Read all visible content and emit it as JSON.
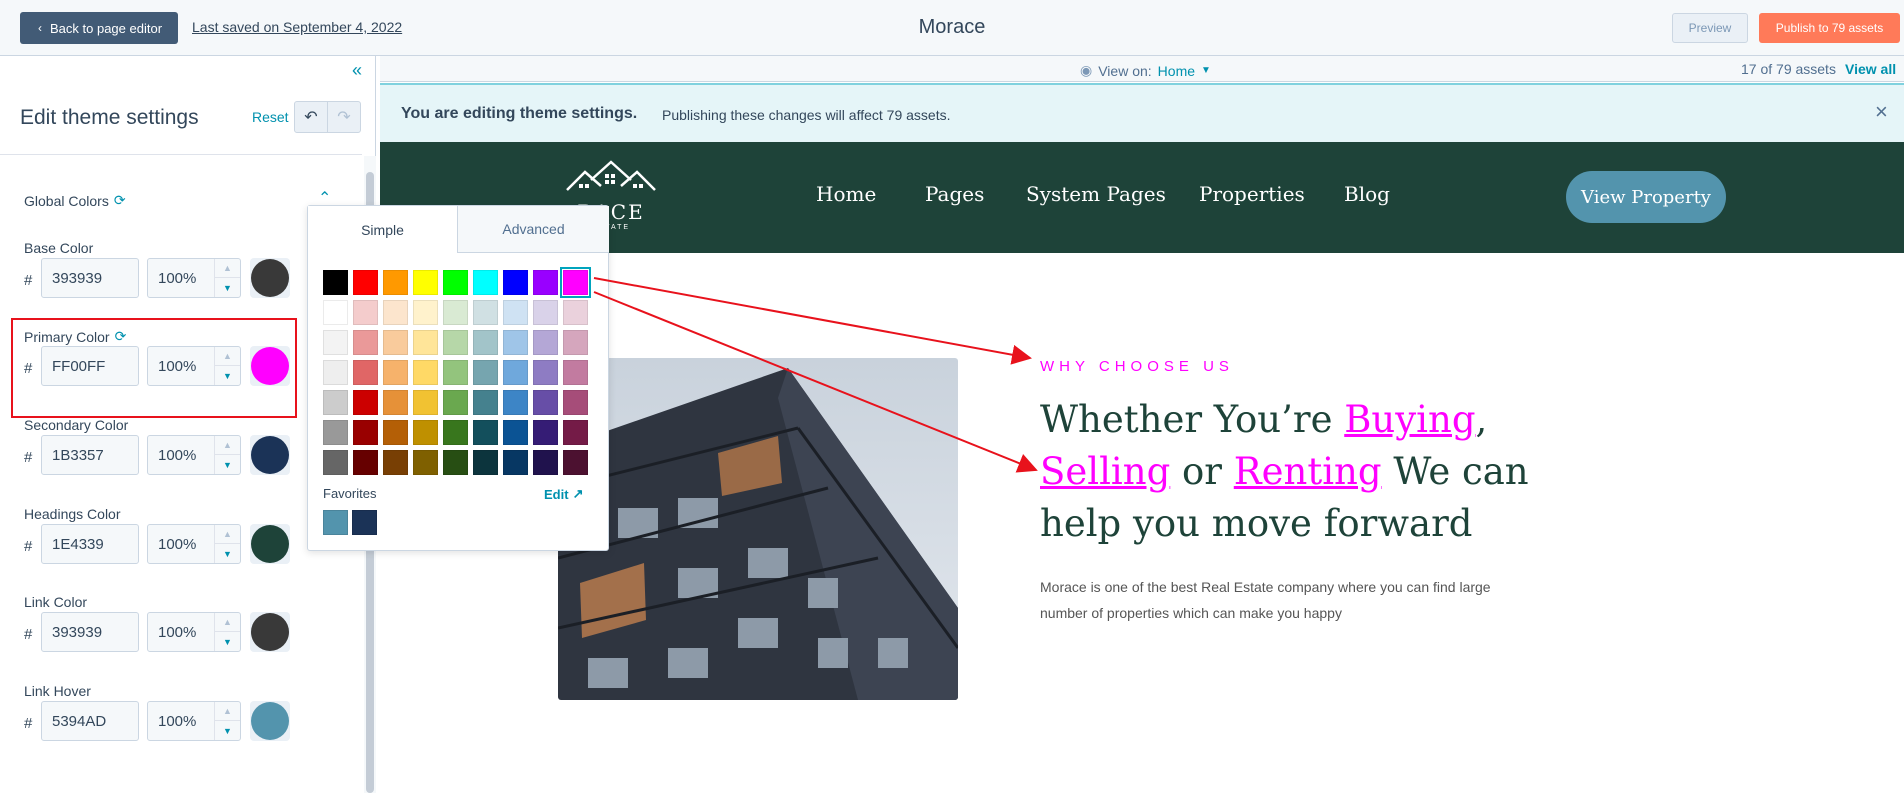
{
  "topbar": {
    "back_label": "Back to page editor",
    "saved_label": "Last saved on September 4, 2022",
    "title": "Morace",
    "preview_label": "Preview",
    "publish_label": "Publish to 79 assets"
  },
  "panel": {
    "title": "Edit theme settings",
    "reset_label": "Reset",
    "group_title": "Global Colors",
    "colors": [
      {
        "label": "Base Color",
        "hex": "393939",
        "opacity": "100%",
        "swatch": "#393939"
      },
      {
        "label": "Primary Color",
        "hex": "FF00FF",
        "opacity": "100%",
        "swatch": "#ff00ff"
      },
      {
        "label": "Secondary Color",
        "hex": "1B3357",
        "opacity": "100%",
        "swatch": "#1b3357"
      },
      {
        "label": "Headings Color",
        "hex": "1E4339",
        "opacity": "100%",
        "swatch": "#1e4339"
      },
      {
        "label": "Link Color",
        "hex": "393939",
        "opacity": "100%",
        "swatch": "#393939"
      },
      {
        "label": "Link Hover",
        "hex": "5394AD",
        "opacity": "100%",
        "swatch": "#5394ad"
      }
    ],
    "hash": "#"
  },
  "picker": {
    "tab_simple": "Simple",
    "tab_advanced": "Advanced",
    "favorites_label": "Favorites",
    "edit_label": "Edit",
    "palette": [
      [
        "#000000",
        "#ff0000",
        "#ff9900",
        "#ffff00",
        "#00ff00",
        "#00ffff",
        "#0000ff",
        "#9900ff",
        "#ff00ff"
      ],
      [
        "#ffffff",
        "#f4cccc",
        "#fce5cd",
        "#fff2cc",
        "#d9ead3",
        "#d0e0e3",
        "#cfe2f3",
        "#d9d2e9",
        "#ead1dc"
      ],
      [
        "#f3f3f3",
        "#ea9999",
        "#f9cb9c",
        "#ffe599",
        "#b6d7a8",
        "#a2c4c9",
        "#9fc5e8",
        "#b4a7d6",
        "#d5a6bd"
      ],
      [
        "#eeeeee",
        "#e06666",
        "#f6b26b",
        "#ffd966",
        "#93c47d",
        "#76a5af",
        "#6fa8dc",
        "#8e7cc3",
        "#c27ba0"
      ],
      [
        "#cccccc",
        "#cc0000",
        "#e69138",
        "#f1c232",
        "#6aa84f",
        "#45818e",
        "#3d85c6",
        "#674ea7",
        "#a64d79"
      ],
      [
        "#999999",
        "#990000",
        "#b45f06",
        "#bf9000",
        "#38761d",
        "#134f5c",
        "#0b5394",
        "#351c75",
        "#741b47"
      ],
      [
        "#666666",
        "#660000",
        "#783f04",
        "#7f6000",
        "#274e13",
        "#0c343d",
        "#073763",
        "#20124d",
        "#4c1130"
      ]
    ],
    "favorites": [
      "#5394ad",
      "#1b3357"
    ]
  },
  "preview": {
    "view_on_label": "View on:",
    "view_on_value": "Home",
    "assets_count": "17 of 79 assets",
    "view_all": "View all",
    "banner_strong": "You are editing theme settings.",
    "banner_text": "Publishing these changes will affect 79 assets."
  },
  "site": {
    "logo_text": "RACE",
    "logo_sub": "ESTATE",
    "nav": [
      "Home",
      "Pages",
      "System Pages",
      "Properties",
      "Blog"
    ],
    "cta": "View Property",
    "eyebrow": "WHY CHOOSE US",
    "headline_1": "Whether You’re ",
    "headline_buying": "Buying",
    "headline_comma": ",",
    "headline_selling": "Selling",
    "headline_or": " or ",
    "headline_renting": "Renting",
    "headline_rest": " We can help you move forward",
    "body": "Morace is one of the best Real Estate company where you can find large number of properties which can make you happy"
  },
  "colors": {
    "header_bg": "#1e4339",
    "primary": "#ff00ff",
    "accent": "#0091ae",
    "publish": "#ff7a59",
    "annotation": "#e8121c"
  },
  "icons": [
    "chevron-left-icon",
    "collapse-icon",
    "undo-icon",
    "redo-icon",
    "sync-icon",
    "chevron-up-icon",
    "eye-icon",
    "caret-down-icon",
    "close-icon",
    "external-link-icon"
  ]
}
